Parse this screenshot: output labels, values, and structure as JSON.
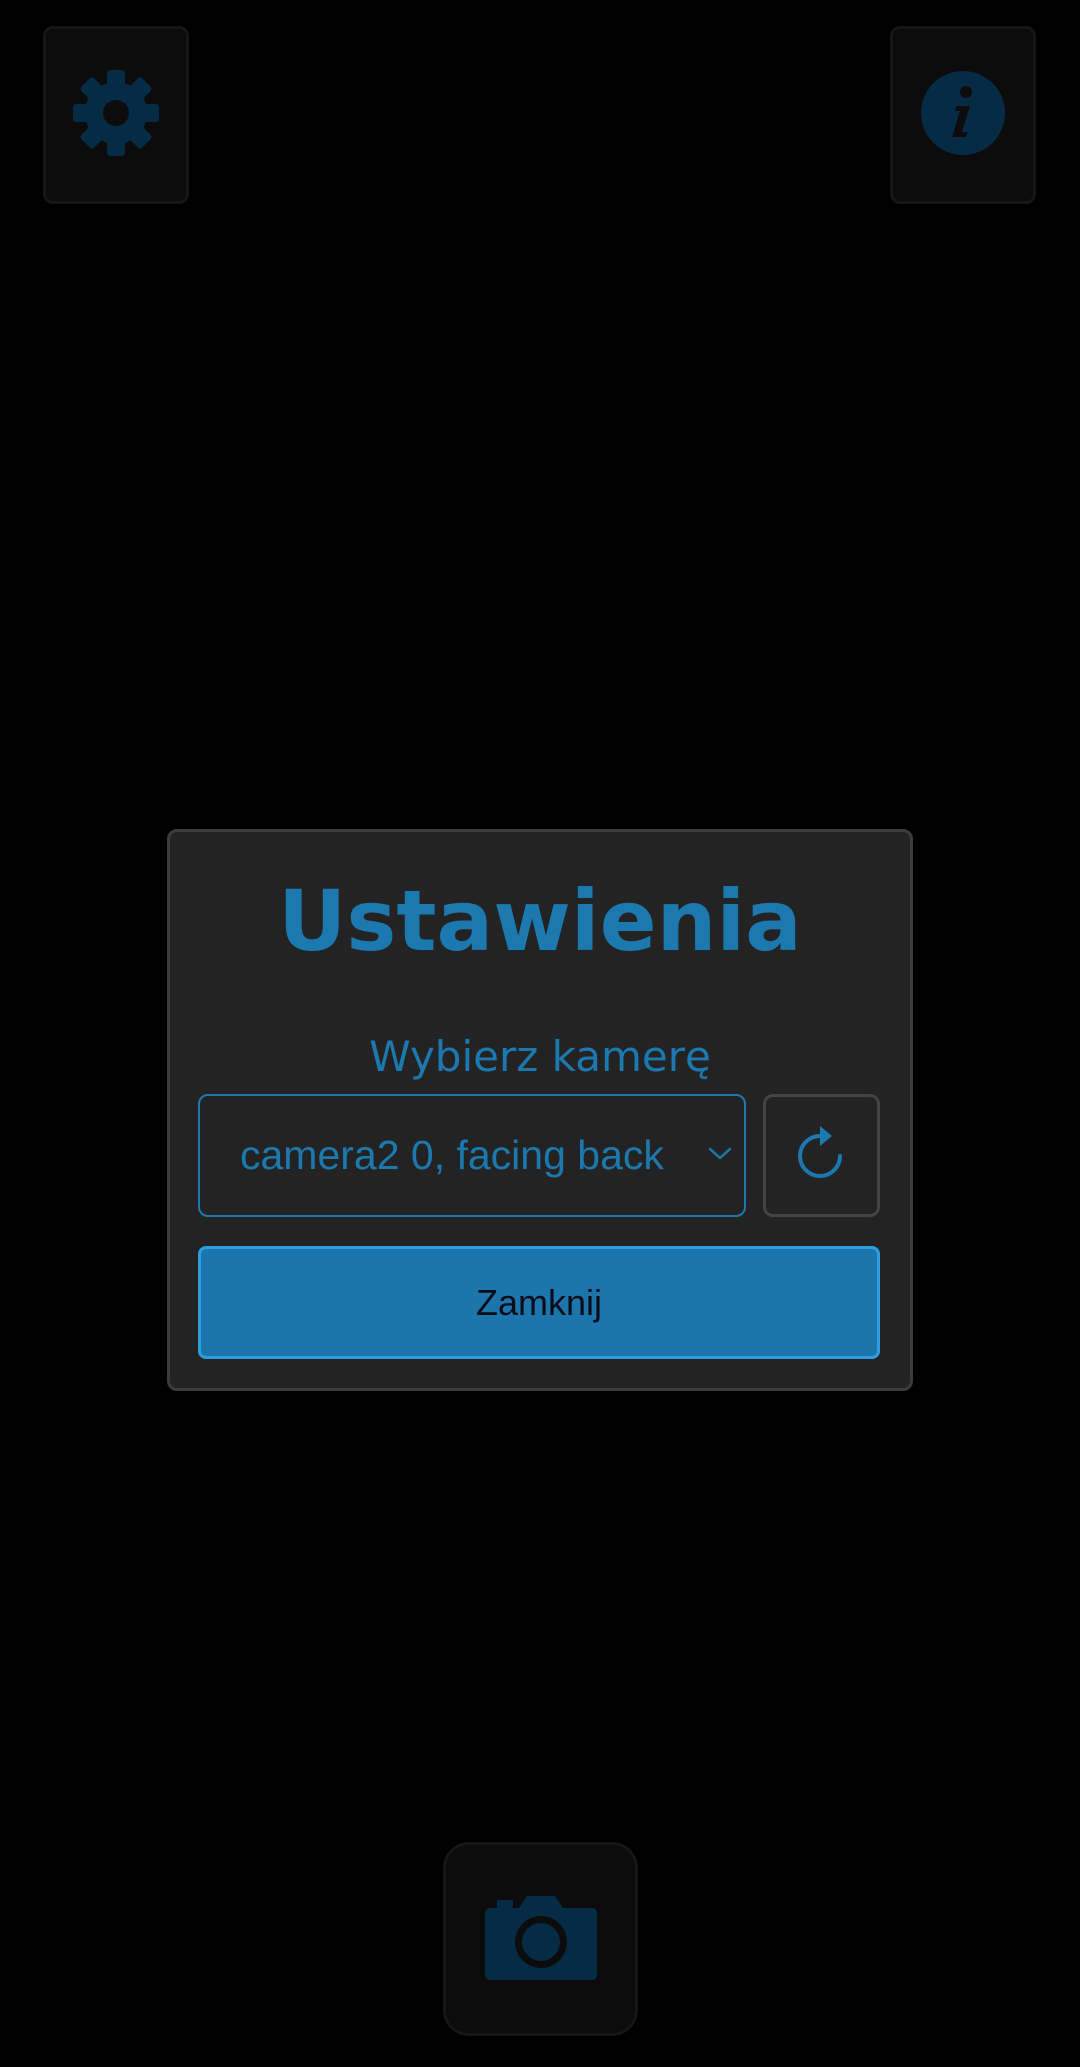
{
  "toolbar": {
    "settings_icon": "gear-icon",
    "info_icon": "info-icon",
    "capture_icon": "camera-icon"
  },
  "dialog": {
    "title": "Ustawienia",
    "camera_label": "Wybierz kamerę",
    "camera_select": {
      "selected_value": "camera2 0, facing back",
      "dropdown_icon": "chevron-down-icon"
    },
    "refresh_icon": "refresh-icon",
    "close_label": "Zamknij"
  },
  "colors": {
    "background": "#000000",
    "accent": "#1c79b0",
    "dialog_background": "#232323",
    "toolbar_icon": "#062c45"
  }
}
